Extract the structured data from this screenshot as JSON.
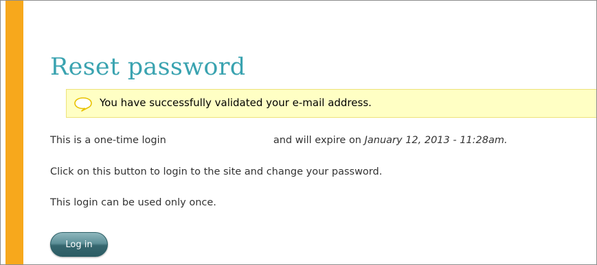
{
  "page": {
    "title": "Reset password"
  },
  "status": {
    "message": "You have successfully validated your e-mail address.",
    "icon": "speech-bubble-icon"
  },
  "body": {
    "line1_part1": "This is a one-time login",
    "line1_part2": "and will expire on ",
    "expiry_date": "January 12, 2013 - 11:28am.",
    "line2": "Click on this button to login to the site and change your password.",
    "line3": "This login can be used only once."
  },
  "actions": {
    "login_label": "Log in"
  },
  "colors": {
    "accent_bar": "#f7a81c",
    "title": "#3aa3b0",
    "status_background": "#ffffc4",
    "button": "#35666e"
  }
}
